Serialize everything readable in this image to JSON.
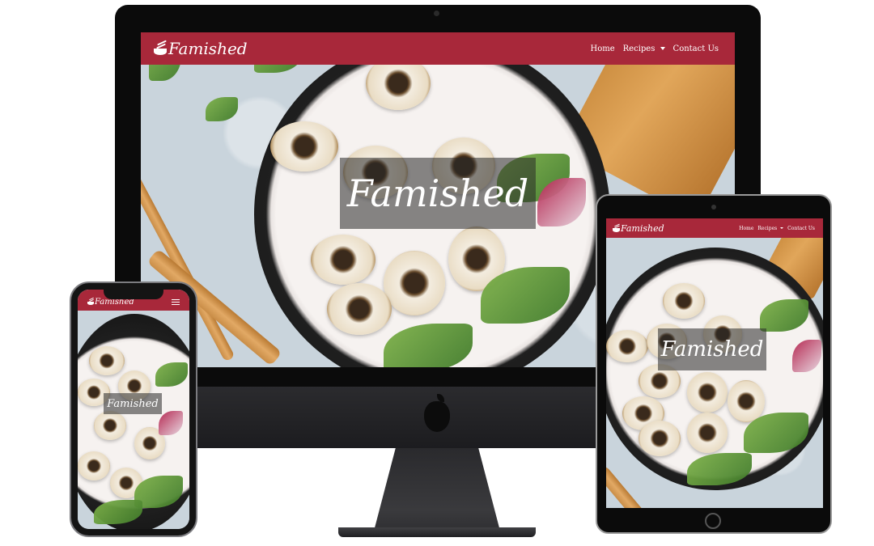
{
  "site": {
    "brand": "Famished",
    "hero_title": "Famished",
    "nav": {
      "home": "Home",
      "recipes": "Recipes",
      "contact": "Contact Us"
    }
  },
  "colors": {
    "navbar": "#a8283a",
    "hero_overlay": "rgba(40,40,40,0.55)"
  },
  "icons": {
    "brand_logo": "bowl-with-chopsticks-icon",
    "dropdown": "caret-down-icon",
    "mobile_menu": "hamburger-menu-icon",
    "device_logo": "apple-logo-icon"
  }
}
